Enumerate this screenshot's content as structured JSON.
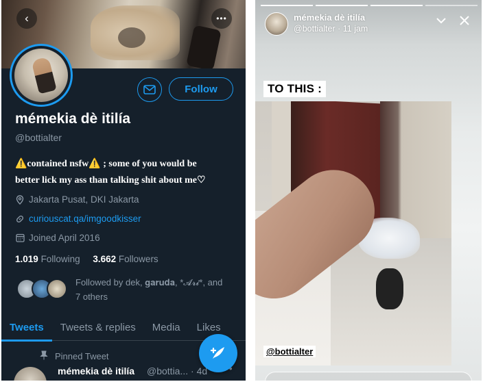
{
  "twitter": {
    "name": "mémekia dè itilía",
    "handle": "@bottialter",
    "follow_label": "Follow",
    "bio_line1": "⚠️contained nsfw⚠️ ; some of you would be",
    "bio_line2": "better lick my ass than talking shit about me♡",
    "location": "Jakarta Pusat, DKI Jakarta",
    "website": "curiouscat.qa/imgoodkisser",
    "joined": "Joined April 2016",
    "following_count": "1.019",
    "following_label": "Following",
    "followers_count": "3.662",
    "followers_label": "Followers",
    "followed_by_line1": "Followed by dek, 𝐠𝐚𝐫𝐮𝐝𝐚, *𝓐𝓻𝓲*, and",
    "followed_by_line2": "7 others",
    "tabs": [
      "Tweets",
      "Tweets & replies",
      "Media",
      "Likes"
    ],
    "pinned_label": "Pinned Tweet",
    "tweet_name": "mémekia dè itilía",
    "tweet_handle": "@bottia... · 4d",
    "accent_color": "#1d9bf0"
  },
  "story": {
    "username": "mémekia dè itilía",
    "subline": "@bottialter · 11 jam",
    "caption": "TO THIS :",
    "mention": "@bottialter"
  }
}
